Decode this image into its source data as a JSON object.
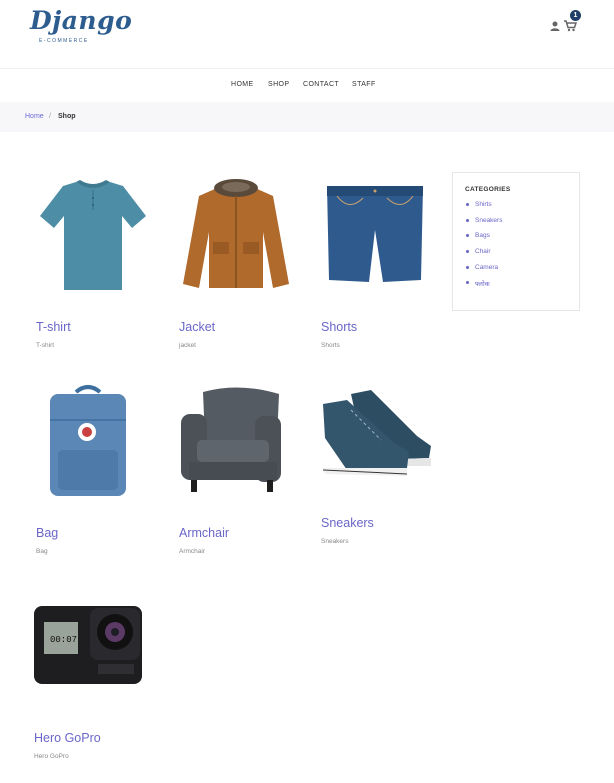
{
  "brand": {
    "name": "Django",
    "tagline": "E-COMMERCE"
  },
  "cart": {
    "count": "1"
  },
  "nav": [
    "HOME",
    "SHOP",
    "CONTACT",
    "STAFF"
  ],
  "breadcrumb": {
    "home": "Home",
    "separator": "/",
    "current": "Shop"
  },
  "products": [
    {
      "name": "T-shirt",
      "category": "T-shirt"
    },
    {
      "name": "Jacket",
      "category": "jacket"
    },
    {
      "name": "Shorts",
      "category": "Shorts"
    },
    {
      "name": "Bag",
      "category": "Bag"
    },
    {
      "name": "Armchair",
      "category": "Armchair"
    },
    {
      "name": "Sneakers",
      "category": "Sneakers"
    },
    {
      "name": "Hero GoPro",
      "category": "Hero GoPro"
    }
  ],
  "categories": {
    "title": "CATEGORIES",
    "items": [
      "Shirts",
      "Sneakers",
      "Bags",
      "Chair",
      "Camera",
      "फ्लोक"
    ]
  },
  "colors": {
    "accent": "#6a66c8",
    "brand": "#2d5c8f",
    "badge": "#1f3f66"
  },
  "icons": [
    "user-icon",
    "cart-icon"
  ]
}
